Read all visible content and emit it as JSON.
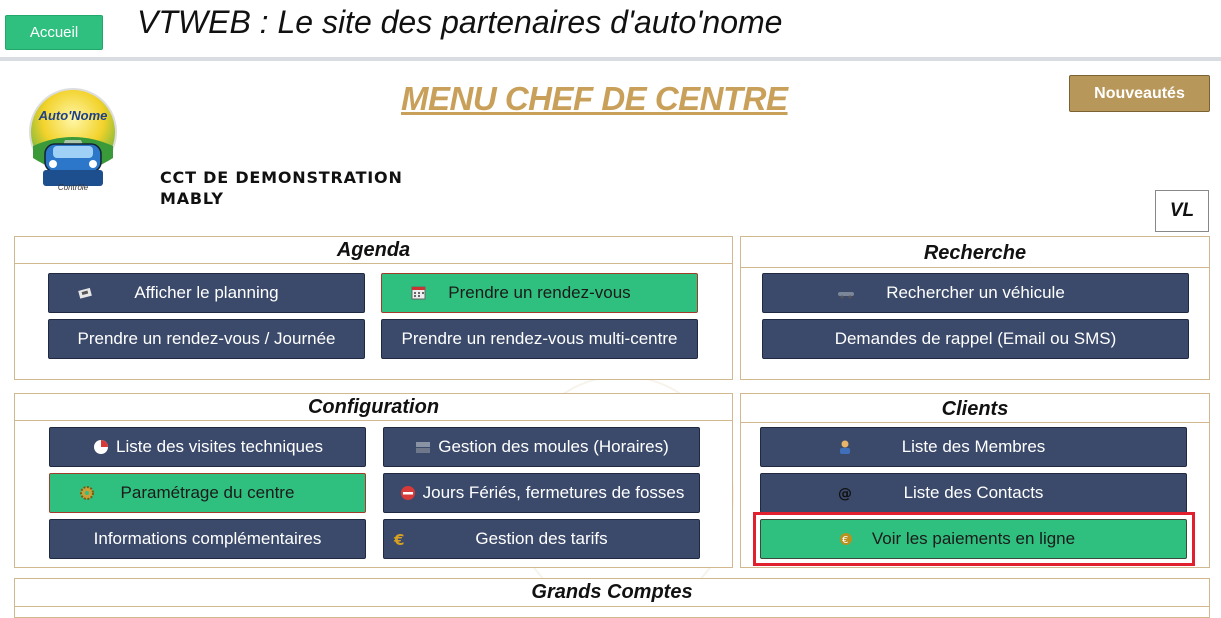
{
  "header": {
    "home_label": "Accueil",
    "site_title": "VTWEB : Le site des partenaires d'auto'nome"
  },
  "menu_title": "MENU CHEF DE CENTRE",
  "news_label": "Nouveautés",
  "logo": {
    "brand": "Auto'Nome",
    "sub": "Contrôle"
  },
  "center": {
    "name": "CCT DE DEMONSTRATION",
    "city": "MABLY"
  },
  "vehicle_type": "VL",
  "agenda": {
    "title": "Agenda",
    "buttons": [
      {
        "label": "Afficher le planning",
        "icon": "calendar-book-icon"
      },
      {
        "label": "Prendre un rendez-vous",
        "icon": "calendar-grid-icon"
      },
      {
        "label": "Prendre un rendez-vous / Journée"
      },
      {
        "label": "Prendre un rendez-vous multi-centre"
      }
    ]
  },
  "recherche": {
    "title": "Recherche",
    "buttons": [
      {
        "label": "Rechercher un véhicule",
        "icon": "car-icon"
      },
      {
        "label": "Demandes de rappel (Email ou SMS)"
      }
    ]
  },
  "configuration": {
    "title": "Configuration",
    "buttons": [
      {
        "label": "Liste des visites techniques",
        "icon": "pie-chart-icon"
      },
      {
        "label": "Gestion des moules (Horaires)",
        "icon": "server-icon"
      },
      {
        "label": "Paramétrage du centre",
        "icon": "gear-icon"
      },
      {
        "label": "Jours Fériés, fermetures de fosses",
        "icon": "no-entry-icon"
      },
      {
        "label": "Informations complémentaires"
      },
      {
        "label": "Gestion des tarifs",
        "icon": "euro-icon"
      }
    ]
  },
  "clients": {
    "title": "Clients",
    "buttons": [
      {
        "label": "Liste des Membres",
        "icon": "user-icon"
      },
      {
        "label": "Liste des Contacts",
        "icon": "at-icon"
      },
      {
        "label": "Voir les paiements en ligne",
        "icon": "euro-coin-icon"
      }
    ]
  },
  "grands_comptes": {
    "title": "Grands Comptes"
  },
  "colors": {
    "nav_button": "#3b4a6b",
    "active_button": "#2fc07f",
    "gold": "#c9a05a",
    "highlight": "#e0202e"
  }
}
